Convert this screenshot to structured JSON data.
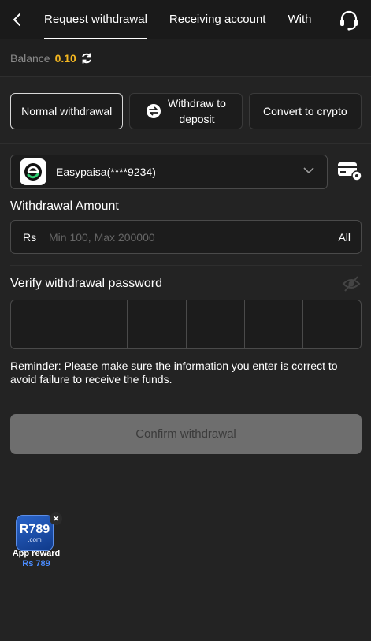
{
  "nav": {
    "tabs": [
      {
        "label": "Request withdrawal",
        "active": true
      },
      {
        "label": "Receiving account",
        "active": false
      },
      {
        "label": "With",
        "active": false
      }
    ]
  },
  "balance": {
    "label": "Balance",
    "value": "0.10"
  },
  "modes": [
    {
      "label": "Normal withdrawal",
      "active": true
    },
    {
      "label": "Withdraw to\ndeposit",
      "active": false,
      "icon": "exchange-icon"
    },
    {
      "label": "Convert to crypto",
      "active": false
    }
  ],
  "account": {
    "name": "Easypaisa(****9234)"
  },
  "amount": {
    "label": "Withdrawal Amount",
    "currency": "Rs",
    "placeholder": "Min 100, Max 200000",
    "all_label": "All"
  },
  "password": {
    "label": "Verify withdrawal password"
  },
  "reminder": "Reminder: Please make sure the information you enter is correct to avoid failure to receive the funds.",
  "confirm_label": "Confirm withdrawal",
  "reward": {
    "logo_text": "R789",
    "logo_sub": ".com",
    "title": "App reward",
    "amount": "Rs 789"
  },
  "colors": {
    "background": "#232323",
    "balance_accent": "#f5b820",
    "confirm_disabled": "#6e6e6e",
    "reward_blue": "#4b8cff"
  }
}
